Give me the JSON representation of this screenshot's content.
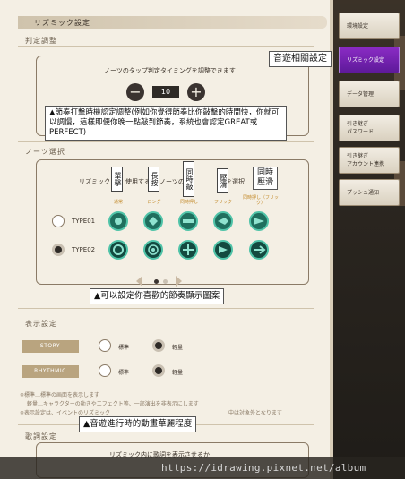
{
  "panel": {
    "header": "リズミック設定",
    "judgement": {
      "section_label": "判定調整",
      "description": "ノーツのタップ判定タイミングを調整できます",
      "minus": "−",
      "plus": "+",
      "value": "10"
    },
    "notes": {
      "section_label": "ノーツ選択",
      "intro_left": "リズミック",
      "intro_mid": "使用する",
      "intro_mid2": "ノーツのタ",
      "intro_right": "を選択",
      "headers": [
        "通常",
        "ロング",
        "同時押し",
        "フリック",
        "同時押し（フリック）"
      ],
      "types": [
        {
          "label": "TYPE01",
          "selected": false
        },
        {
          "label": "TYPE02",
          "selected": true
        }
      ]
    },
    "display": {
      "section_label": "表示設定",
      "rows": [
        {
          "label": "STORY",
          "opt1": "標準",
          "opt2": "軽量",
          "selected": "opt2"
        },
        {
          "label": "RHYTHMIC",
          "opt1": "標準",
          "opt2": "軽量",
          "selected": "opt2"
        }
      ],
      "note1": "※標準…標準の画面を表示します",
      "note2": "軽量…キャラクターの動きやエフェクト等、一部演出を非表示にします",
      "note3": "※表示設定は、イベントのリズミック",
      "note3b": "中は対象外となります"
    },
    "lyrics": {
      "section_label": "歌詞設定",
      "description": "リズミック内に歌詞を表示させるか"
    }
  },
  "menu": [
    {
      "label": "環境設定",
      "active": false
    },
    {
      "label": "リズミック設定",
      "active": true
    },
    {
      "label": "データ管理",
      "active": false
    },
    {
      "label": "引き継ぎ\nパスワード",
      "active": false
    },
    {
      "label": "引き継ぎ\nアカウント連携",
      "active": false
    },
    {
      "label": "プッシュ通知",
      "active": false
    }
  ],
  "annotations": {
    "menu_callout": "音遊相關設定",
    "timing_callout": "▲節奏打擊時機認定調整(例如你覺得節奏比你敲擊的時間快，你就可以調慢，這樣即便你晚一點敲到節奏，系統也會認定GREAT或PERFECT)",
    "col_tap": "單擊",
    "col_long": "長按",
    "col_simul": "同時敲",
    "col_flick": "壓滑",
    "col_simul_flick": "同時壓滑",
    "notes_callout": "▲可以設定你喜歡的節奏顯示圖案",
    "display_callout": "▲音遊進行時的動畫華麗程度"
  },
  "watermark": "https://idrawing.pixnet.net/album",
  "colors": {
    "panel_bg": "#f4efe4",
    "accent_purple": "#7a22b8",
    "note_green": "#1f6f5e",
    "note_ring": "#4fc3a8",
    "pill": "#b9a47f"
  }
}
